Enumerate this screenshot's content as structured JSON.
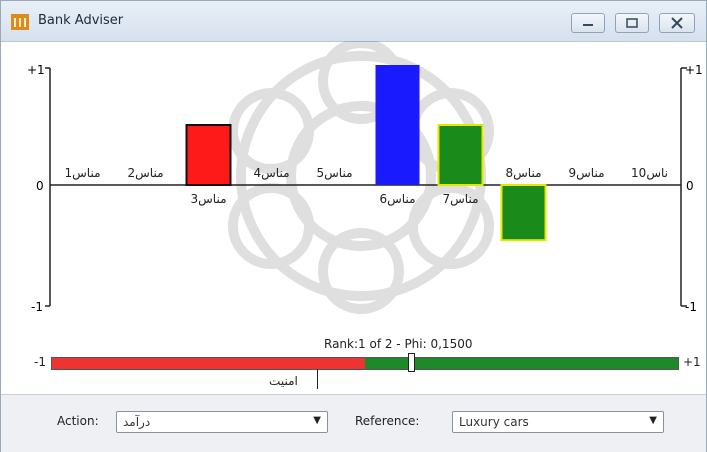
{
  "window": {
    "title": "Bank Adviser"
  },
  "chart_data": {
    "type": "bar",
    "categories": [
      "مناس1",
      "مناس2",
      "مناس3",
      "مناس4",
      "مناس5",
      "مناس6",
      "مناس7",
      "مناس8",
      "مناس9",
      "ناس10"
    ],
    "values": [
      0,
      0,
      0.5,
      0,
      0,
      1.0,
      0.5,
      -0.46,
      0,
      0
    ],
    "bar_colors": [
      "",
      "",
      "#ff1a1a",
      "",
      "",
      "#1a1aff",
      "#1a8a1a",
      "#1a8a1a",
      "",
      ""
    ],
    "bar_outlines": [
      "",
      "",
      "#111111",
      "",
      "",
      "",
      "#e6e600",
      "#e6e600",
      "",
      ""
    ],
    "ylim": [
      -1,
      1
    ],
    "y_ticks": {
      "top": "+1",
      "middle": "0",
      "bottom": "-1"
    }
  },
  "rank": {
    "label": "Rank:1 of 2 - Phi: 0,1500",
    "min_label": "-1",
    "max_label": "+1",
    "value": 0.15,
    "marker_label": "امنیت",
    "marker_value": -0.15,
    "colors": {
      "negative": "#ee3333",
      "positive": "#1d8a2a"
    }
  },
  "footer": {
    "action_label": "Action:",
    "action_value": "درآمد",
    "reference_label": "Reference:",
    "reference_value": "Luxury cars"
  }
}
